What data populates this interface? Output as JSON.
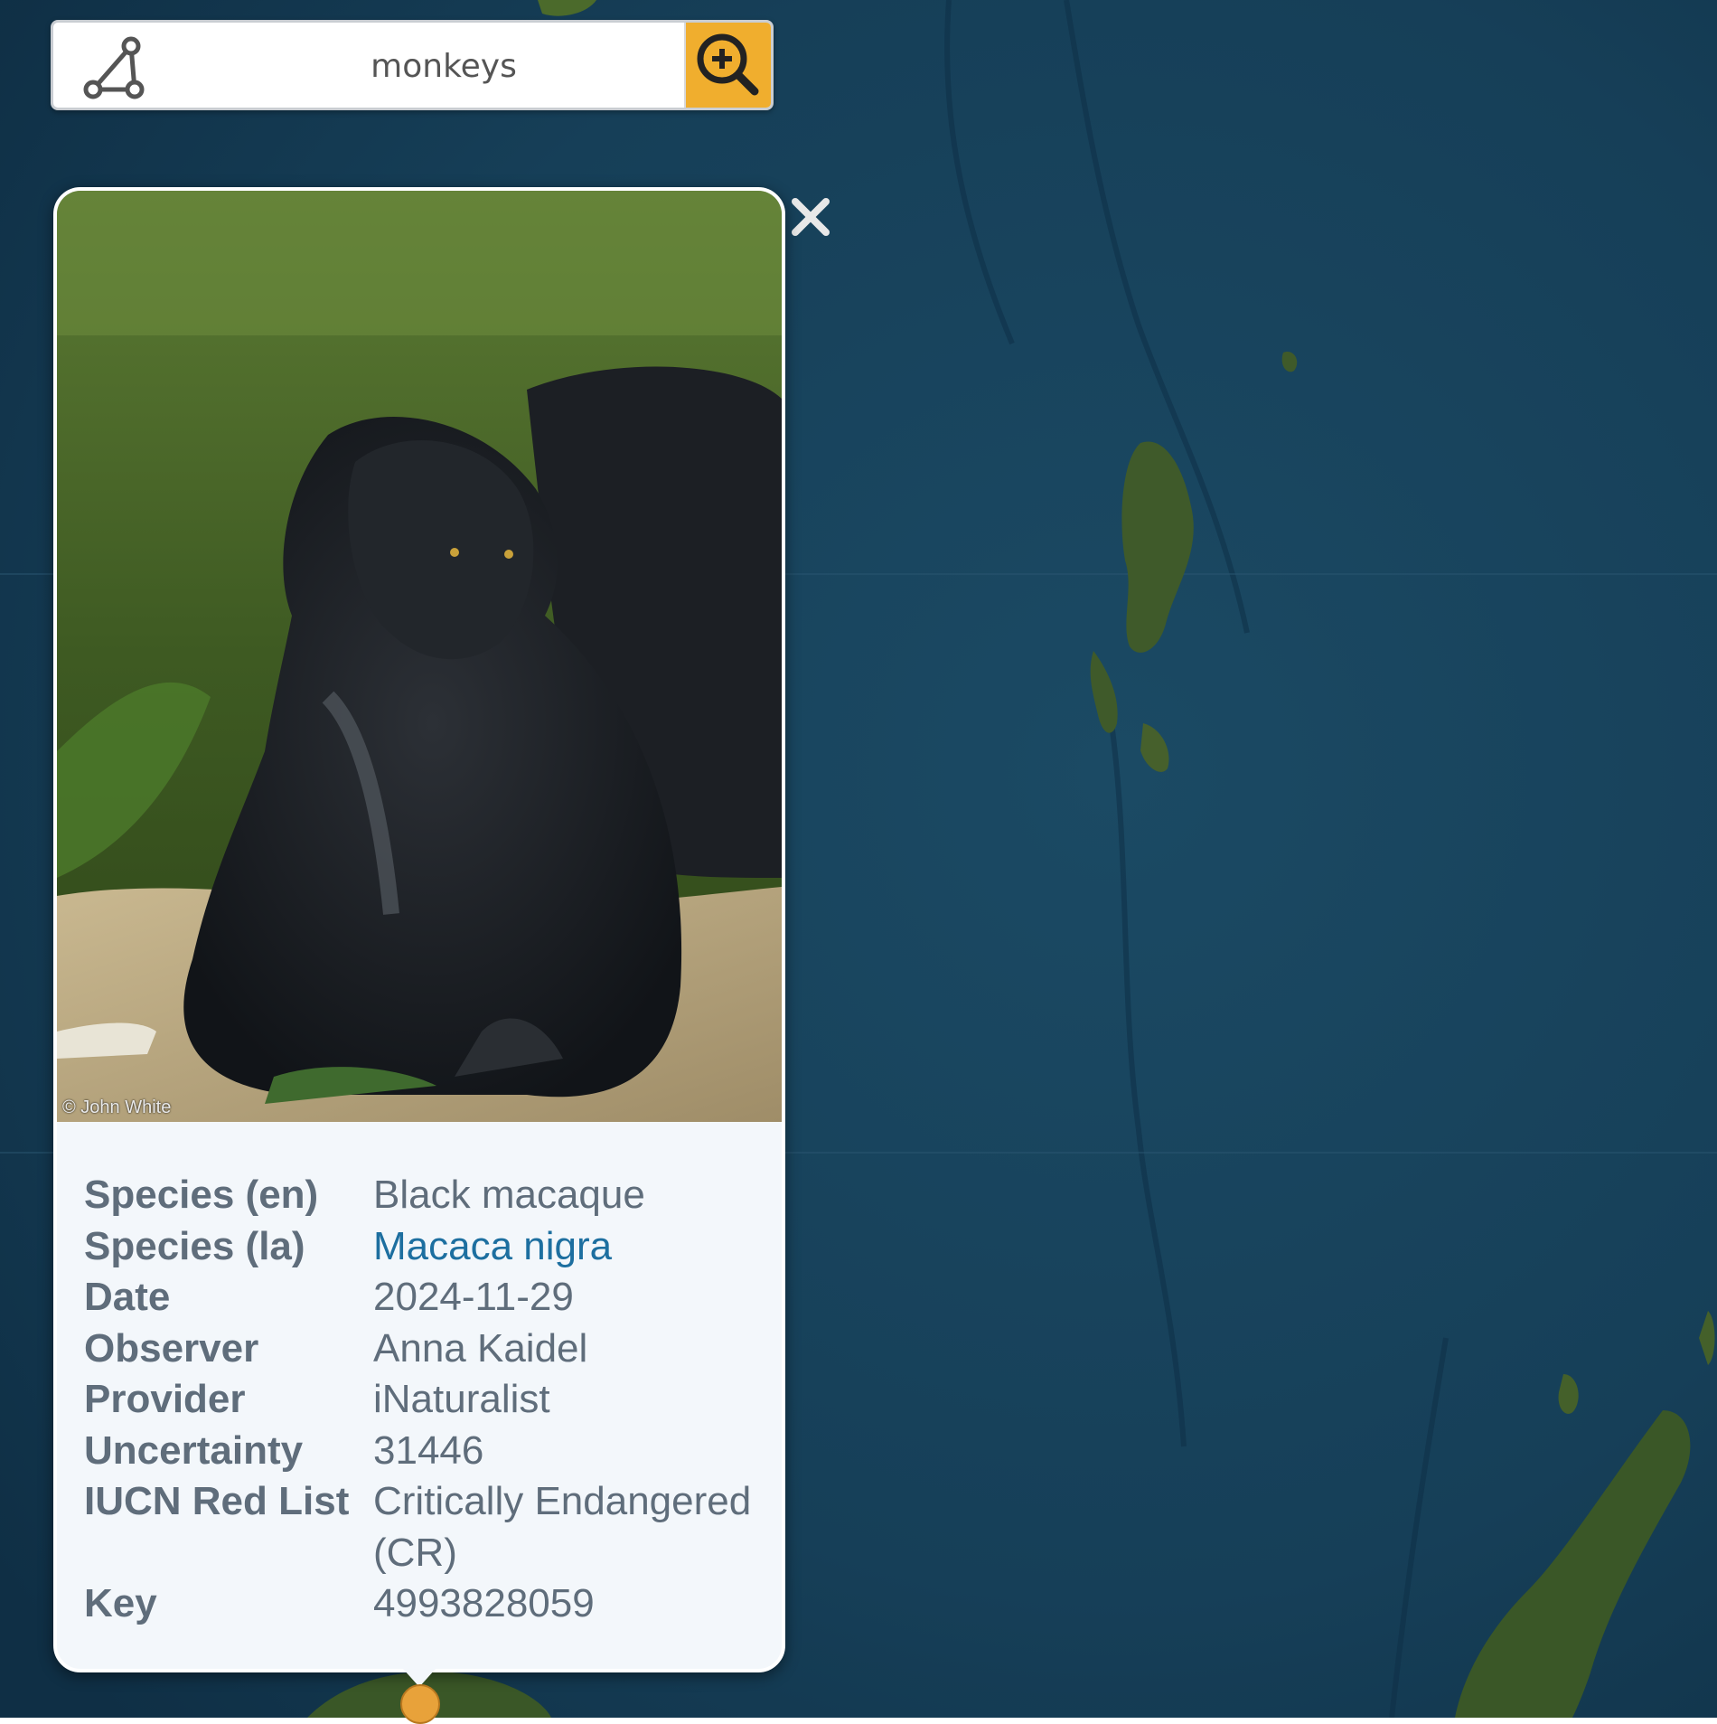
{
  "search": {
    "value": "monkeys"
  },
  "popup": {
    "photo_credit": "© John White",
    "fields": [
      {
        "label": "Species (en)",
        "value": "Black macaque"
      },
      {
        "label": "Species (la)",
        "value": "Macaca nigra"
      },
      {
        "label": "Date",
        "value": "2024-11-29"
      },
      {
        "label": "Observer",
        "value": "Anna Kaidel"
      },
      {
        "label": "Provider",
        "value": "iNaturalist"
      },
      {
        "label": "Uncertainty",
        "value": "31446"
      },
      {
        "label": "IUCN Red List",
        "value": "Critically Endangered (CR)"
      },
      {
        "label": "Key",
        "value": "4993828059"
      }
    ]
  },
  "icons": {
    "draw": "polygon-draw-icon",
    "search": "zoom-in-search-icon",
    "close": "close-icon",
    "marker": "occurrence-marker"
  },
  "colors": {
    "accent": "#f0ae2e",
    "link": "#1d6fa0",
    "ocean": "#143b55",
    "label": "#5f6d7b"
  }
}
